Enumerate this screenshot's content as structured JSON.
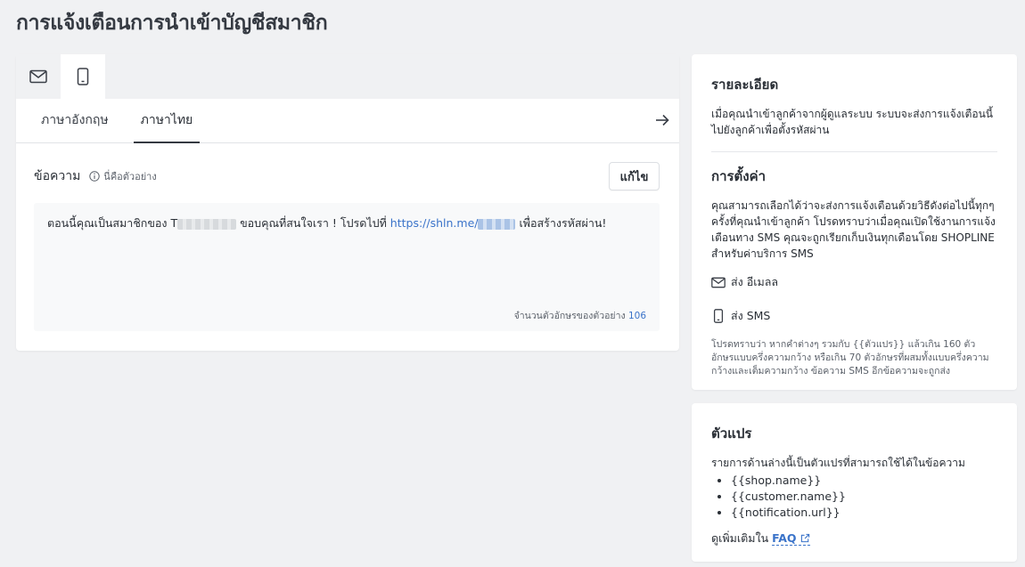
{
  "page": {
    "title": "การแจ้งเตือนการนำเข้าบัญชีสมาชิก"
  },
  "channel_tabs": [
    {
      "icon": "mail-icon",
      "active": false
    },
    {
      "icon": "mobile-phone-icon",
      "active": true
    }
  ],
  "lang_tabs": [
    {
      "label": "ภาษาอังกฤษ",
      "active": false
    },
    {
      "label": "ภาษาไทย",
      "active": true
    }
  ],
  "message": {
    "label": "ข้อความ",
    "hint": "นี่คือตัวอย่าง",
    "edit_label": "แก้ไข",
    "text_part1": "ตอนนี้คุณเป็นสมาชิกของ ",
    "shop_initial": "T",
    "text_part2": " ขอบคุณที่สนใจเรา ! โปรดไปที่ ",
    "link_text": "https://shln.me/",
    "text_part3": " เพื่อสร้างรหัสผ่าน!",
    "char_count_label": "จำนวนตัวอักษรของตัวอย่าง",
    "char_count": "106"
  },
  "details": {
    "title": "รายละเอียด",
    "text": "เมื่อคุณนำเข้าลูกค้าจากผู้ดูแลระบบ ระบบจะส่งการแจ้งเตือนนี้ไปยังลูกค้าเพื่อตั้งรหัสผ่าน"
  },
  "settings": {
    "title": "การตั้งค่า",
    "text": "คุณสามารถเลือกได้ว่าจะส่งการแจ้งเตือนด้วยวิธีดังต่อไปนี้ทุกๆครั้งที่คุณนำเข้าลูกค้า โปรดทราบว่าเมื่อคุณเปิดใช้งานการแจ้งเตือนทาง SMS คุณจะถูกเรียกเก็บเงินทุกเดือนโดย SHOPLINE สำหรับค่าบริการ SMS",
    "option_email": "ส่ง อีเมลล",
    "option_sms": "ส่ง SMS",
    "note": "โปรดทราบว่า หากคำต่างๆ รวมกับ {{ตัวแปร}} แล้วเกิน 160 ตัวอักษรแบบครึ่งความกว้าง หรือเกิน 70 ตัวอักษรที่ผสมทั้งแบบครึ่งความกว้างและเต็มความกว้าง ข้อความ SMS อีกข้อความจะถูกส่ง"
  },
  "variables": {
    "title": "ตัวแปร",
    "intro": "รายการด้านล่างนี้เป็นตัวแปรที่สามารถใช้ได้ในข้อความ",
    "items": [
      "{{shop.name}}",
      "{{customer.name}}",
      "{{notification.url}}"
    ],
    "more_label": "ดูเพิ่มเติมใน",
    "faq_label": "FAQ"
  }
}
